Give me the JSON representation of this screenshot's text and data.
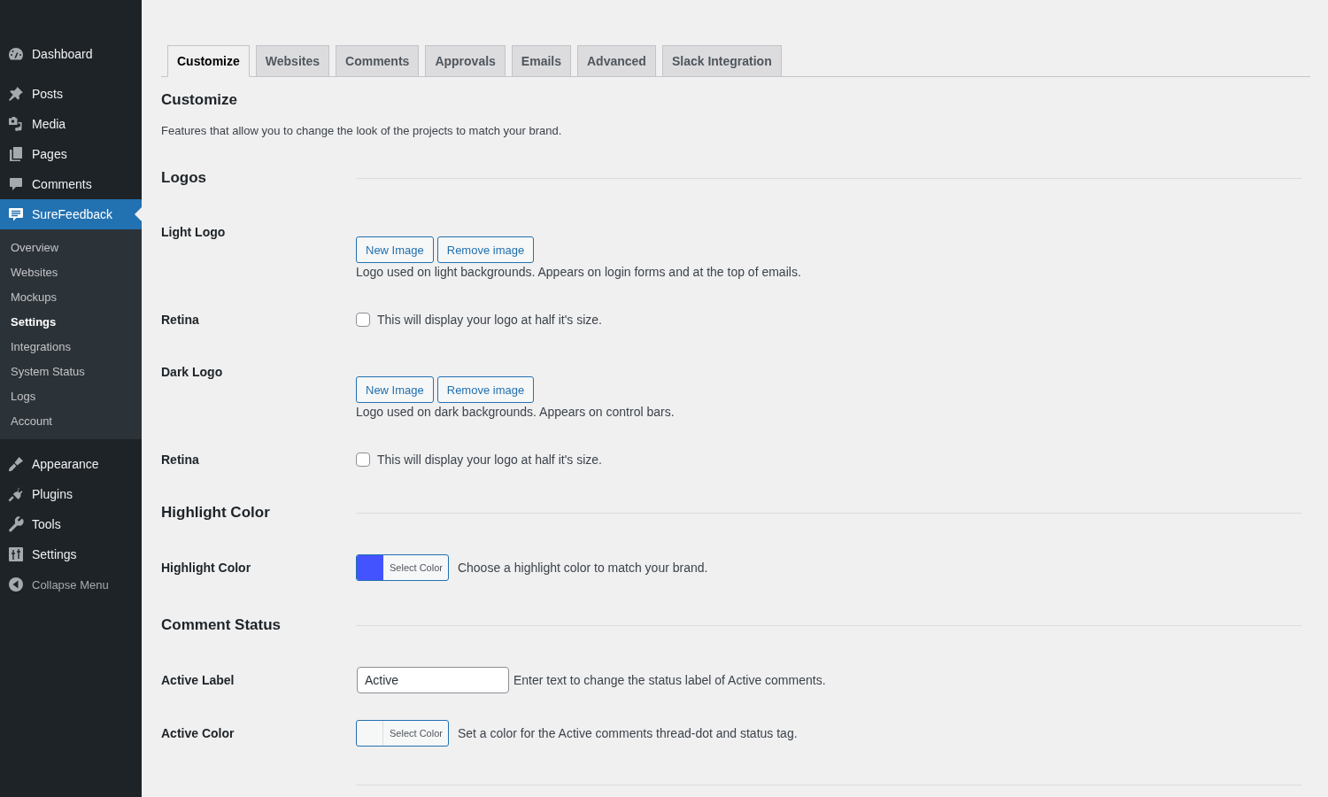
{
  "sidebar": {
    "groups": [
      {
        "items": [
          {
            "label": "Dashboard",
            "selected": false
          }
        ]
      },
      {
        "items": [
          {
            "label": "Posts",
            "selected": false
          },
          {
            "label": "Media",
            "selected": false
          },
          {
            "label": "Pages",
            "selected": false
          },
          {
            "label": "Comments",
            "selected": false
          },
          {
            "label": "SureFeedback",
            "selected": true,
            "submenu": [
              {
                "label": "Overview",
                "selected": false
              },
              {
                "label": "Websites",
                "selected": false
              },
              {
                "label": "Mockups",
                "selected": false
              },
              {
                "label": "Settings",
                "selected": true
              },
              {
                "label": "Integrations",
                "selected": false
              },
              {
                "label": "System Status",
                "selected": false
              },
              {
                "label": "Logs",
                "selected": false
              },
              {
                "label": "Account",
                "selected": false
              }
            ]
          }
        ]
      },
      {
        "items": [
          {
            "label": "Appearance",
            "selected": false
          },
          {
            "label": "Plugins",
            "selected": false
          },
          {
            "label": "Tools",
            "selected": false
          },
          {
            "label": "Settings",
            "selected": false
          }
        ]
      }
    ],
    "collapse_label": "Collapse Menu"
  },
  "tabs": [
    {
      "label": "Customize",
      "selected": true
    },
    {
      "label": "Websites",
      "selected": false
    },
    {
      "label": "Comments",
      "selected": false
    },
    {
      "label": "Approvals",
      "selected": false
    },
    {
      "label": "Emails",
      "selected": false
    },
    {
      "label": "Advanced",
      "selected": false
    },
    {
      "label": "Slack Integration",
      "selected": false
    }
  ],
  "page": {
    "title": "Customize",
    "description": "Features that allow you to change the look of the projects to match your brand."
  },
  "sections": [
    {
      "title": "Logos",
      "rows": [
        {
          "kind": "image",
          "label": "Light Logo",
          "buttons": [
            "New Image",
            "Remove image"
          ],
          "description": "Logo used on light backgrounds. Appears on login forms and at the top of emails."
        },
        {
          "kind": "checkbox",
          "label": "Retina",
          "checked": false,
          "text": "This will display your logo at half it's size."
        },
        {
          "kind": "image",
          "label": "Dark Logo",
          "buttons": [
            "New Image",
            "Remove image"
          ],
          "description": "Logo used on dark backgrounds. Appears on control bars."
        },
        {
          "kind": "checkbox",
          "label": "Retina",
          "checked": false,
          "text": "This will display your logo at half it's size."
        }
      ]
    },
    {
      "title": "Highlight Color",
      "rows": [
        {
          "kind": "color",
          "label": "Highlight Color",
          "color": "#4353ff",
          "button_label": "Select Color",
          "description": "Choose a highlight color to match your brand."
        }
      ]
    },
    {
      "title": "Comment Status",
      "rows": [
        {
          "kind": "text",
          "label": "Active Label",
          "value": "Active",
          "description": "Enter text to change the status label of Active comments."
        },
        {
          "kind": "color",
          "label": "Active Color",
          "button_label": "Select Color",
          "description": "Set a color for the Active comments thread-dot and status tag."
        }
      ]
    }
  ]
}
